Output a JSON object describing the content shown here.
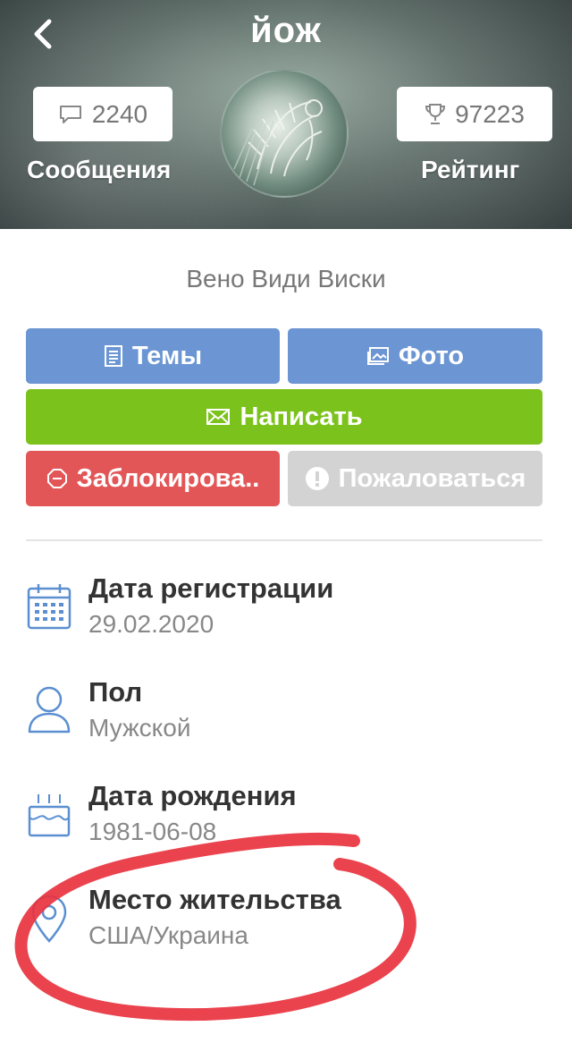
{
  "header": {
    "title": "йож",
    "back_icon": "chevron-left-icon",
    "messages": {
      "count": "2240",
      "label": "Сообщения",
      "icon": "speech-bubble-icon"
    },
    "rating": {
      "count": "97223",
      "label": "Рейтинг",
      "icon": "trophy-icon"
    }
  },
  "profile": {
    "status": "Вено Види Виски"
  },
  "actions": {
    "topics": {
      "label": "Темы",
      "icon": "document-icon"
    },
    "photo": {
      "label": "Фото",
      "icon": "image-icon"
    },
    "write": {
      "label": "Написать",
      "icon": "envelope-icon"
    },
    "block": {
      "label": "Заблокирова..",
      "icon": "block-octagon-icon"
    },
    "report": {
      "label": "Пожаловаться",
      "icon": "exclamation-circle-icon"
    }
  },
  "info": {
    "registration": {
      "title": "Дата регистрации",
      "value": "29.02.2020",
      "icon": "calendar-icon"
    },
    "gender": {
      "title": "Пол",
      "value": "Мужской",
      "icon": "person-icon"
    },
    "birthday": {
      "title": "Дата рождения",
      "value": "1981-06-08",
      "icon": "birthday-cake-icon"
    },
    "location": {
      "title": "Место жительства",
      "value": "США/Украина",
      "icon": "location-pin-icon"
    }
  },
  "colors": {
    "blue_button": "#6b95d3",
    "green_button": "#7cc21c",
    "red_button": "#e35657",
    "gray_button": "#d3d3d3",
    "icon_blue": "#5b8fd1",
    "highlight_circle": "#e8333f"
  }
}
